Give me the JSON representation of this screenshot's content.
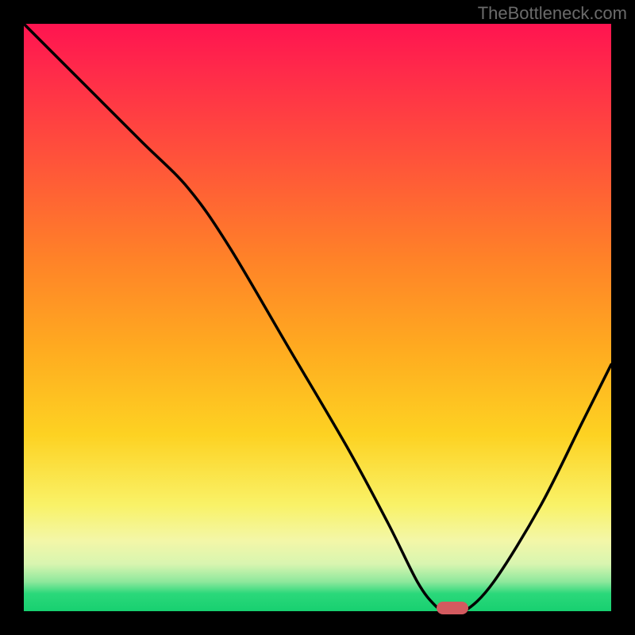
{
  "watermark": "TheBottleneck.com",
  "chart_data": {
    "type": "line",
    "title": "",
    "xlabel": "",
    "ylabel": "",
    "xlim": [
      0,
      100
    ],
    "ylim": [
      0,
      100
    ],
    "background_gradient": {
      "top": "#ff1450",
      "mid": "#ffaa20",
      "bottom": "#17d070"
    },
    "series": [
      {
        "name": "bottleneck-curve",
        "x": [
          0,
          10,
          20,
          28,
          35,
          45,
          55,
          62,
          67,
          70,
          72,
          75,
          80,
          88,
          95,
          100
        ],
        "y": [
          100,
          90,
          80,
          72,
          62,
          45,
          28,
          15,
          5,
          1,
          0,
          0,
          5,
          18,
          32,
          42
        ]
      }
    ],
    "marker": {
      "x": 73,
      "y": 0.5,
      "color": "#d35a5f"
    },
    "grid": false,
    "legend": false
  }
}
